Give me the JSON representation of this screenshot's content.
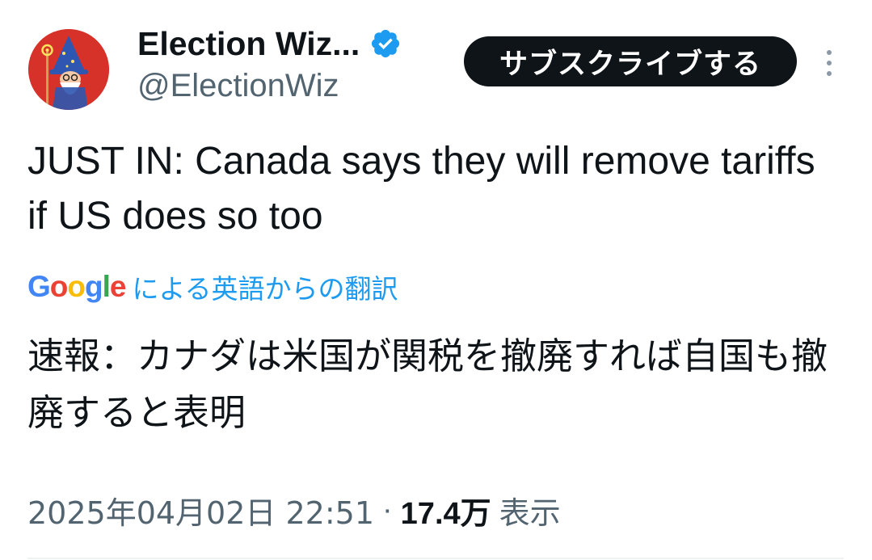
{
  "author": {
    "display_name": "Election Wiz...",
    "handle": "@ElectionWiz",
    "verified": true,
    "avatar_icon": "wizard-avatar"
  },
  "actions": {
    "subscribe_label": "サブスクライブする",
    "more_icon": "more-vertical-icon"
  },
  "tweet": {
    "text": "JUST IN: Canada says they will remove tariffs if US does so too",
    "translation_label": "による英語からの翻訳",
    "translated_text": "速報：カナダは米国が関税を撤廃すれば自国も撤廃すると表明"
  },
  "google_logo": {
    "letters": [
      "G",
      "o",
      "o",
      "g",
      "l",
      "e"
    ]
  },
  "meta": {
    "timestamp": "2025年04月02日 22:51",
    "separator": "·",
    "views": "17.4万",
    "views_label": "表示"
  },
  "colors": {
    "accent": "#1d9bf0",
    "text_primary": "#0f1419",
    "text_secondary": "#536471",
    "avatar_bg": "#d7322a",
    "button_bg": "#0f1419",
    "google_blue": "#4285f4",
    "google_red": "#ea4335",
    "google_yellow": "#fbbc05",
    "google_green": "#34a853"
  }
}
